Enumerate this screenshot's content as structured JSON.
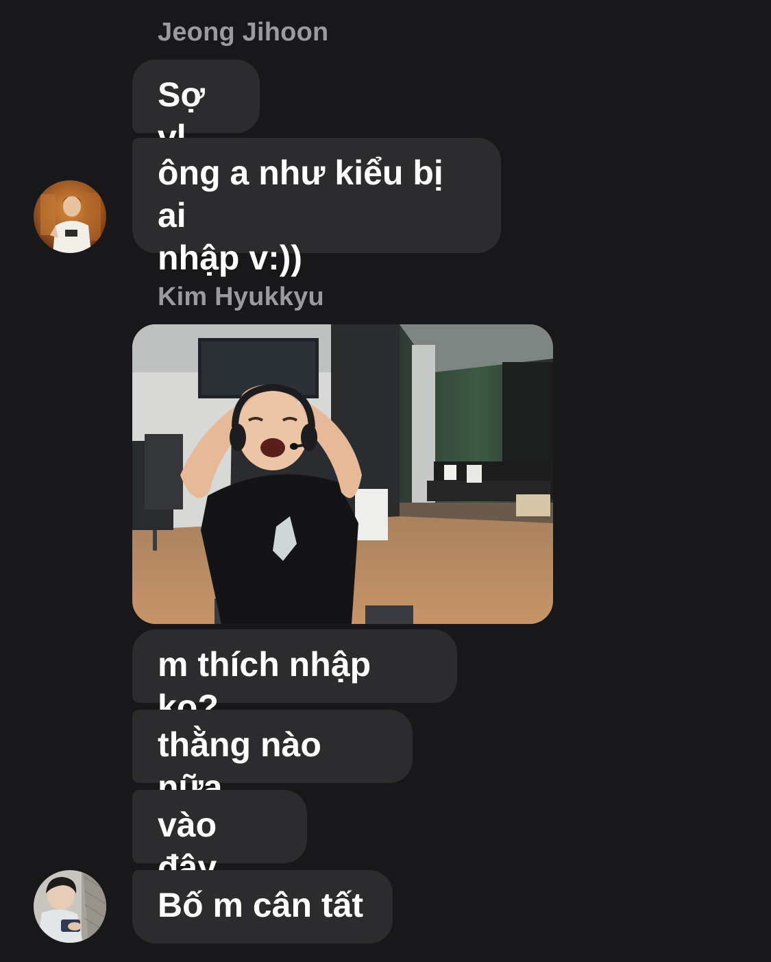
{
  "thread": {
    "groups": [
      {
        "sender": "Jeong Jihoon",
        "messages": [
          {
            "text": "Sợ vl"
          },
          {
            "text": "ông a như kiểu bị ai\nnhập v:))"
          }
        ],
        "avatar": "user-avatar-photo"
      },
      {
        "sender": "Kim Hyukkyu",
        "image": {
          "kind": "photo-attachment",
          "icon": "image-photo"
        },
        "messages": [
          {
            "text": "m thích nhập ko?"
          },
          {
            "text": "thằng nào nữa"
          },
          {
            "text": "vào đây"
          },
          {
            "text": "Bố m cân tất"
          }
        ],
        "avatar": "user-avatar-photo"
      }
    ]
  },
  "colors": {
    "background": "#18181a",
    "bubble": "#2c2c2e",
    "text": "#ffffff",
    "sender_name": "#9a9a9f"
  }
}
